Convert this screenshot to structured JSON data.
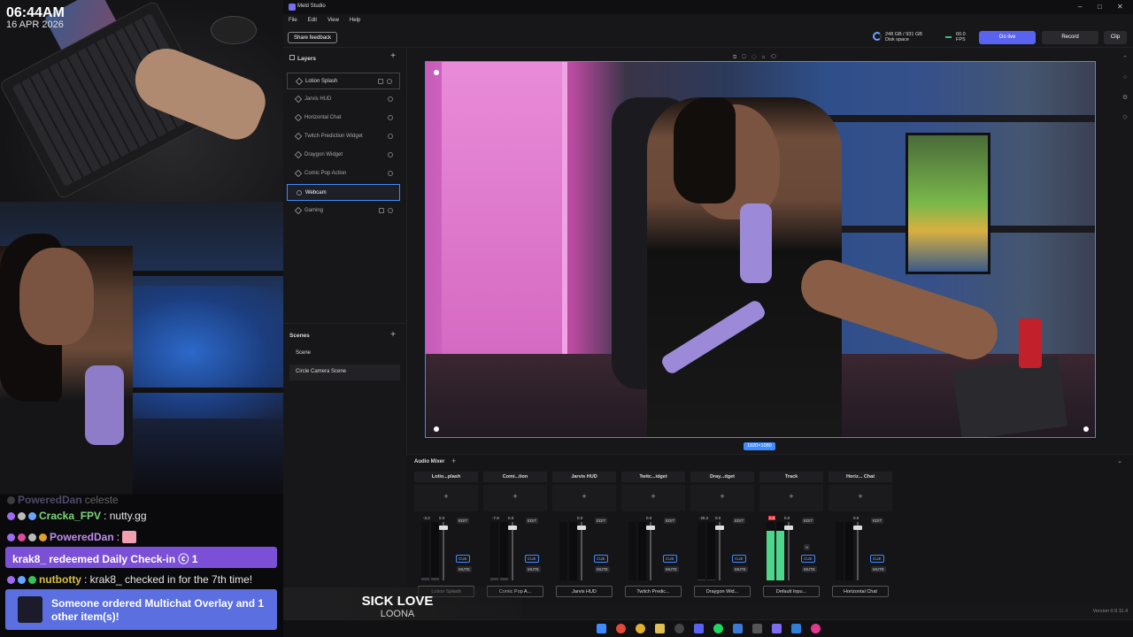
{
  "overlay": {
    "clock_time": "06:44AM",
    "clock_date": "16 APR 2026"
  },
  "chat": {
    "messages": [
      {
        "user": "PoweredDan",
        "text": "celeste",
        "color": "#b7a5f0"
      },
      {
        "user": "Cracka_FPV",
        "text": ": nutty.gg",
        "color": "#7cd67a"
      },
      {
        "user": "PoweredDan",
        "text": ":",
        "color": "#c08cf0"
      },
      {
        "user": "nutbotty",
        "text": ": krak8_ checked in for the 7th time!",
        "color": "#d6c040"
      }
    ],
    "redeem": "krak8_ redeemed Daily Check-in ⓒ 1",
    "order": "Someone ordered Multichat Overlay and 1 other item(s)!"
  },
  "now_playing": {
    "song": "SICK LOVE",
    "artist": "LOONA"
  },
  "window": {
    "title": "Meld Studio",
    "menu": [
      "File",
      "Edit",
      "View",
      "Help"
    ]
  },
  "topbar": {
    "feedback": "Share feedback",
    "disk_line1": "248 GB / 931 GB",
    "disk_line2": "Disk space",
    "fps_line1": "60.0",
    "fps_line2": "FPS",
    "go_live": "Go live",
    "record": "Record",
    "clip": "Clip"
  },
  "layers": {
    "header": "Layers",
    "items": [
      {
        "label": "Lotion Splash",
        "state": "hover"
      },
      {
        "label": "Jarvis HUD",
        "state": "normal"
      },
      {
        "label": "Horizontal Chat",
        "state": "normal"
      },
      {
        "label": "Twitch Prediction Widget",
        "state": "normal"
      },
      {
        "label": "Draygon Widget",
        "state": "normal"
      },
      {
        "label": "Comic Pop Action",
        "state": "normal"
      },
      {
        "label": "Webcam",
        "state": "selected"
      },
      {
        "label": "Gaming",
        "state": "normal"
      }
    ]
  },
  "scenes": {
    "header": "Scenes",
    "items": [
      {
        "label": "Scene",
        "selected": false
      },
      {
        "label": "Circle Camera Scene",
        "selected": true
      }
    ]
  },
  "canvas": {
    "resolution": "1920×1080"
  },
  "mixer": {
    "header": "Audio Mixer",
    "strips": [
      {
        "name": "Lotio...plash",
        "level": "-3.2",
        "gain": "0.0",
        "source": "Lotion Splash",
        "meter": 0.05
      },
      {
        "name": "Comi...tion",
        "level": "-7.8",
        "gain": "0.0",
        "source": "Comic Pop A...",
        "meter": 0.05
      },
      {
        "name": "Jarvis HUD",
        "level": "",
        "gain": "0.0",
        "source": "Jarvis HUD",
        "meter": 0.0
      },
      {
        "name": "Twitc...idget",
        "level": "",
        "gain": "0.0",
        "source": "Twitch Predic...",
        "meter": 0.0
      },
      {
        "name": "Dray...dget",
        "level": "-26.2",
        "gain": "0.0",
        "source": "Draygon Wid...",
        "meter": 0.02
      },
      {
        "name": "Track",
        "level": "0.0",
        "gain": "0.0",
        "source": "Default Inpu...",
        "meter": 0.85
      },
      {
        "name": "Horiz... Chat",
        "level": "",
        "gain": "0.0",
        "source": "Horizontal Chat",
        "meter": 0.0
      }
    ],
    "edit_label": "EDIT",
    "cue_label": "CUE",
    "mute_label": "MUTE"
  },
  "version": "Version 0.9.11.4",
  "colors": {
    "accent": "#3d8bff",
    "go_live": "#5a63f0",
    "redeem_bg": "#7b4fd6",
    "order_bg": "#5b6fe0",
    "meter_green": "#4fd68a",
    "meter_red": "#e0303a"
  }
}
